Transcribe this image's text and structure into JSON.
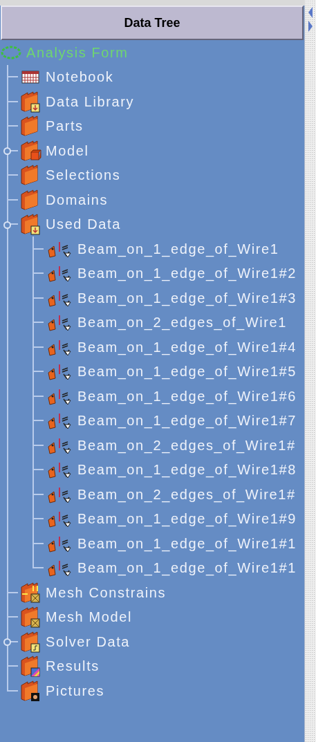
{
  "header": {
    "title": "Data Tree"
  },
  "tree": {
    "label": "Analysis Form",
    "kind": "root",
    "children": [
      {
        "label": "Notebook",
        "kind": "notebook",
        "expandable": false
      },
      {
        "label": "Data Library",
        "kind": "folder-download",
        "expandable": false
      },
      {
        "label": "Parts",
        "kind": "folder",
        "expandable": false
      },
      {
        "label": "Model",
        "kind": "folder-cube",
        "expandable": true
      },
      {
        "label": "Selections",
        "kind": "folder",
        "expandable": false
      },
      {
        "label": "Domains",
        "kind": "folder",
        "expandable": false
      },
      {
        "label": "Used Data",
        "kind": "folder-download",
        "expandable": true,
        "children": [
          {
            "label": "Beam_on_1_edge_of_Wire1",
            "kind": "beam"
          },
          {
            "label": "Beam_on_1_edge_of_Wire1#2",
            "kind": "beam"
          },
          {
            "label": "Beam_on_1_edge_of_Wire1#3",
            "kind": "beam"
          },
          {
            "label": "Beam_on_2_edges_of_Wire1",
            "kind": "beam"
          },
          {
            "label": "Beam_on_1_edge_of_Wire1#4",
            "kind": "beam"
          },
          {
            "label": "Beam_on_1_edge_of_Wire1#5",
            "kind": "beam"
          },
          {
            "label": "Beam_on_1_edge_of_Wire1#6",
            "kind": "beam"
          },
          {
            "label": "Beam_on_1_edge_of_Wire1#7",
            "kind": "beam"
          },
          {
            "label": "Beam_on_2_edges_of_Wire1#",
            "kind": "beam"
          },
          {
            "label": "Beam_on_1_edge_of_Wire1#8",
            "kind": "beam"
          },
          {
            "label": "Beam_on_2_edges_of_Wire1#",
            "kind": "beam"
          },
          {
            "label": "Beam_on_1_edge_of_Wire1#9",
            "kind": "beam"
          },
          {
            "label": "Beam_on_1_edge_of_Wire1#1",
            "kind": "beam"
          },
          {
            "label": "Beam_on_1_edge_of_Wire1#1",
            "kind": "beam"
          }
        ]
      },
      {
        "label": "Mesh Constrains",
        "kind": "folder-constraint",
        "expandable": false
      },
      {
        "label": "Mesh Model",
        "kind": "folder-mesh",
        "expandable": false
      },
      {
        "label": "Solver Data",
        "kind": "folder-solver",
        "expandable": true
      },
      {
        "label": "Results",
        "kind": "folder-results",
        "expandable": false
      },
      {
        "label": "Pictures",
        "kind": "folder-pictures",
        "expandable": false
      }
    ]
  }
}
